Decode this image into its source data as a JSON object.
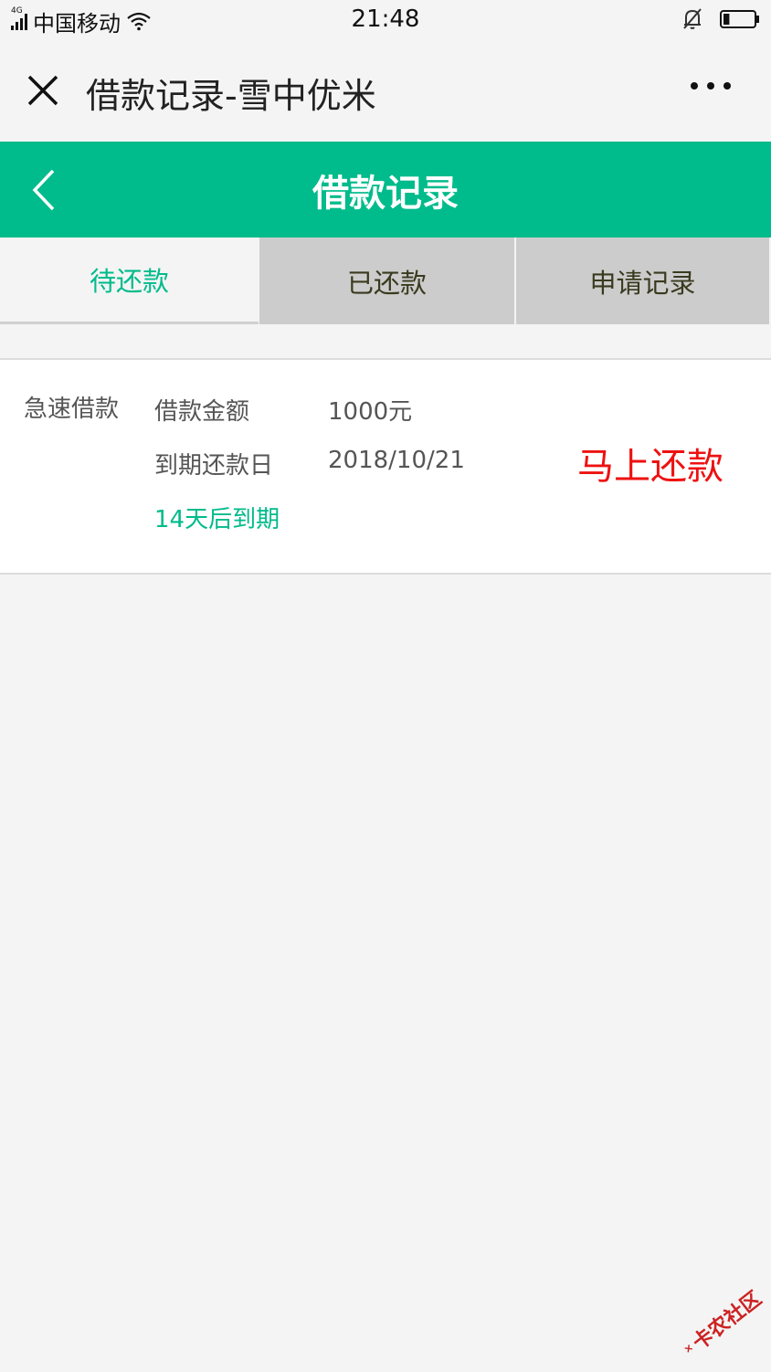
{
  "status_bar": {
    "network_type": "4G",
    "carrier": "中国移动",
    "time": "21:48",
    "battery_level": 0.2,
    "icons": [
      "signal-icon",
      "wifi-icon",
      "bell-muted-icon",
      "battery-icon"
    ]
  },
  "title_bar": {
    "title": "借款记录-雪中优米",
    "close_icon": "close-icon",
    "more_icon": "more-icon"
  },
  "header": {
    "title": "借款记录",
    "back_icon": "chevron-left-icon",
    "background_color": "#00bb8b"
  },
  "tabs": [
    {
      "label": "待还款",
      "active": true
    },
    {
      "label": "已还款",
      "active": false
    },
    {
      "label": "申请记录",
      "active": false
    }
  ],
  "loan": {
    "type": "急速借款",
    "amount_label": "借款金额",
    "amount_value": "1000元",
    "due_label": "到期还款日",
    "due_value": "2018/10/21",
    "due_note": "14天后到期",
    "repay_button": "马上还款"
  },
  "colors": {
    "accent": "#00bb8b",
    "repay": "#ee1111",
    "tab_inactive_bg": "#cccccc",
    "page_bg": "#f4f4f4"
  },
  "watermark": {
    "text": "卡农社区"
  }
}
